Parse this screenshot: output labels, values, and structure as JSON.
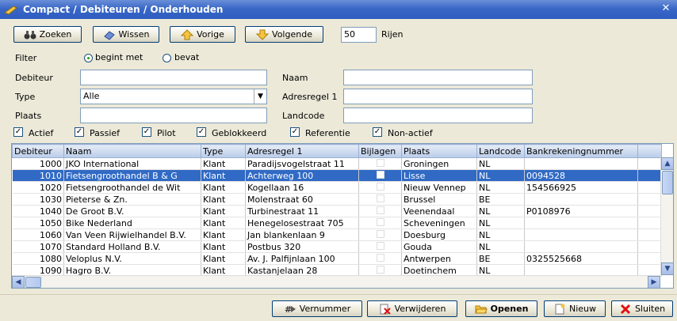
{
  "window": {
    "title": "Compact / Debiteuren / Onderhouden"
  },
  "toolbar": {
    "search_label": "Zoeken",
    "clear_label": "Wissen",
    "prev_label": "Vorige",
    "next_label": "Volgende",
    "rows_value": "50",
    "rows_label": "Rijen"
  },
  "filter": {
    "label": "Filter",
    "starts_with": "begint met",
    "contains": "bevat",
    "selected": "begint met"
  },
  "form": {
    "debiteur_label": "Debiteur",
    "debiteur_value": "",
    "naam_label": "Naam",
    "naam_value": "",
    "type_label": "Type",
    "type_value": "Alle",
    "adres_label": "Adresregel 1",
    "adres_value": "",
    "plaats_label": "Plaats",
    "plaats_value": "",
    "landcode_label": "Landcode",
    "landcode_value": ""
  },
  "checks": [
    {
      "label": "Actief",
      "checked": true
    },
    {
      "label": "Passief",
      "checked": true
    },
    {
      "label": "Pilot",
      "checked": true
    },
    {
      "label": "Geblokkeerd",
      "checked": true
    },
    {
      "label": "Referentie",
      "checked": true
    },
    {
      "label": "Non-actief",
      "checked": true
    }
  ],
  "grid": {
    "columns": [
      "Debiteur",
      "Naam",
      "Type",
      "Adresregel 1",
      "Bijlagen",
      "Plaats",
      "Landcode",
      "Bankrekeningnummer"
    ],
    "rows": [
      [
        "1000",
        "JKO International",
        "Klant",
        "Paradijsvogelstraat 11",
        "",
        "Groningen",
        "NL",
        ""
      ],
      [
        "1010",
        "Fietsengroothandel B & G",
        "Klant",
        "Achterweg 100",
        "",
        "Lisse",
        "NL",
        "0094528"
      ],
      [
        "1020",
        "Fietsengroothandel de Wit",
        "Klant",
        "Kogellaan 16",
        "",
        "Nieuw Vennep",
        "NL",
        "154566925"
      ],
      [
        "1030",
        "Pieterse & Zn.",
        "Klant",
        "Molenstraat 60",
        "",
        "Brussel",
        "BE",
        ""
      ],
      [
        "1040",
        "De Groot B.V.",
        "Klant",
        "Turbinestraat 11",
        "",
        "Veenendaal",
        "NL",
        "P0108976"
      ],
      [
        "1050",
        "Bike Nederland",
        "Klant",
        "Henegelosestraat 705",
        "",
        "Scheveningen",
        "NL",
        ""
      ],
      [
        "1060",
        "Van Veen Rijwielhandel B.V.",
        "Klant",
        "Jan blankenlaan 9",
        "",
        "Doesburg",
        "NL",
        ""
      ],
      [
        "1070",
        "Standard Holland B.V.",
        "Klant",
        "Postbus 320",
        "",
        "Gouda",
        "NL",
        ""
      ],
      [
        "1080",
        "Veloplus N.V.",
        "Klant",
        "Av. J. Palfijnlaan 100",
        "",
        "Antwerpen",
        "BE",
        "0325525668"
      ],
      [
        "1090",
        "Hagro B.V.",
        "Klant",
        "Kastanjelaan 28",
        "",
        "Doetinchem",
        "NL",
        ""
      ]
    ],
    "selected_index": 1
  },
  "footer": {
    "vernummer_label": "Vernummer",
    "delete_label": "Verwijderen",
    "open_label": "Openen",
    "new_label": "Nieuw",
    "close_label": "Sluiten"
  },
  "colors": {
    "titlebar": "#2d5cc0",
    "selection": "#316ac5",
    "background": "#ece9d8"
  }
}
